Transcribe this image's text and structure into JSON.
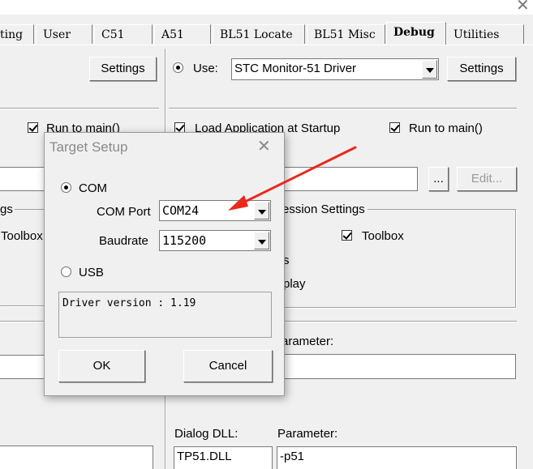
{
  "tabs": [
    {
      "label": "ting",
      "active": false
    },
    {
      "label": "User",
      "active": false
    },
    {
      "label": "C51",
      "active": false
    },
    {
      "label": "A51",
      "active": false
    },
    {
      "label": "BL51 Locate",
      "active": false
    },
    {
      "label": "BL51 Misc",
      "active": false
    },
    {
      "label": "Debug",
      "active": true
    },
    {
      "label": "Utilities",
      "active": false
    }
  ],
  "left_panel": {
    "settings_label": "Settings",
    "run_to_main_label": "Run to main()",
    "run_to_main_checked": true,
    "group_label_partial": "gs",
    "toolbox_label": "Toolbox",
    "toolbox_checked": true
  },
  "right_panel": {
    "use_label": "Use:",
    "use_selected": true,
    "driver_value": "STC Monitor-51 Driver",
    "settings_label": "Settings",
    "load_app_label": "Load Application at Startup",
    "load_app_checked": true,
    "run_to_main_label": "Run to main()",
    "run_to_main_checked": true,
    "browse_label": "...",
    "edit_label": "Edit...",
    "session_settings_label": "ession Settings",
    "toolbox_label": "Toolbox",
    "toolbox_checked": true,
    "partial_s": "s",
    "partial_play": "play",
    "parameter_label_partial": "arameter:",
    "dialog_dll_label": "Dialog DLL:",
    "dialog_dll_value": "TP51.DLL",
    "parameter_label": "Parameter:",
    "parameter_value": "-p51"
  },
  "dialog": {
    "title": "Target Setup",
    "com_label": "COM",
    "com_selected": true,
    "com_port_label": "COM Port",
    "com_port_value": "COM24",
    "baudrate_label": "Baudrate",
    "baudrate_value": "115200",
    "usb_label": "USB",
    "usb_selected": false,
    "driver_version": "Driver version : 1.19",
    "ok_label": "OK",
    "cancel_label": "Cancel"
  },
  "annotation": {
    "arrow_color": "#e8291c"
  }
}
